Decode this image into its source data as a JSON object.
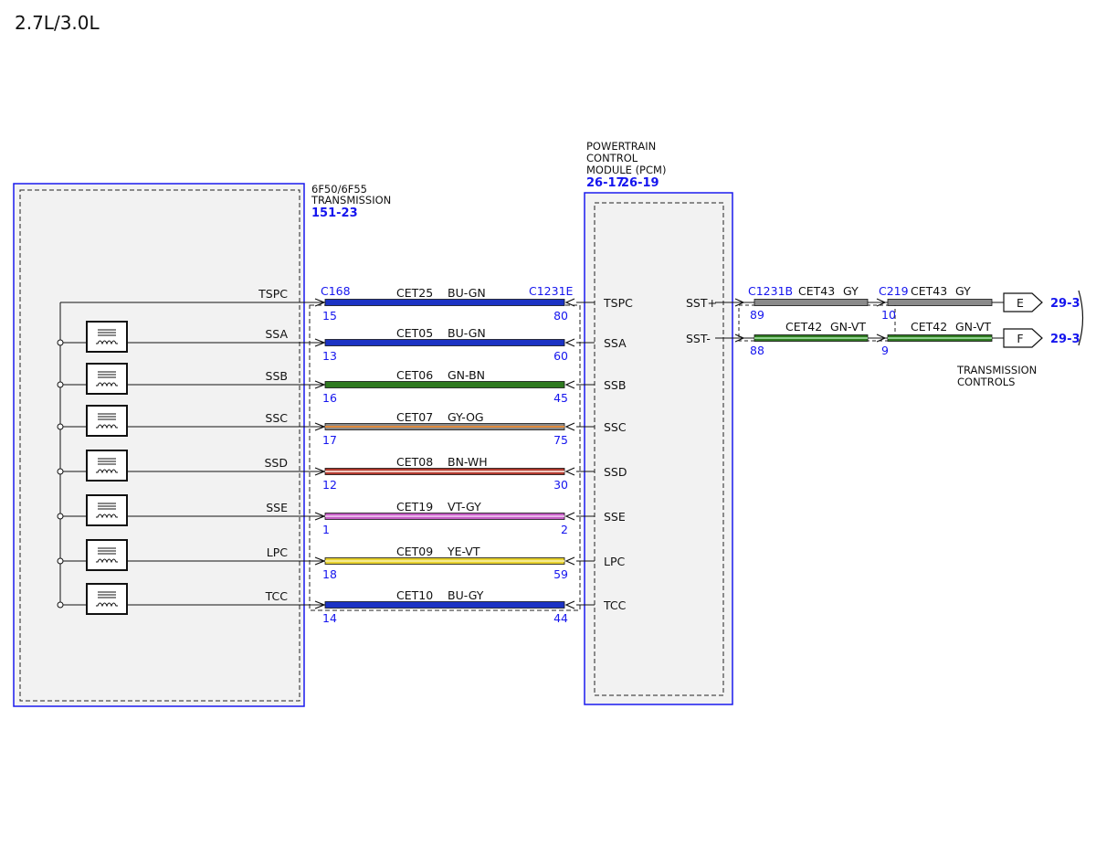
{
  "title": "2.7L/3.0L",
  "transmission": {
    "name_lines": [
      "6F50/6F55",
      "TRANSMISSION"
    ],
    "ref": "151-23",
    "connector": "C168"
  },
  "pcm": {
    "name_lines": [
      "POWERTRAIN",
      "CONTROL",
      "MODULE (PCM)"
    ],
    "refs": [
      "26-17",
      "26-19"
    ],
    "connector": "C1231E"
  },
  "solenoid_circuits": [
    {
      "signal": "TSPC",
      "circuit": "CET25",
      "color_code": "BU-GN",
      "trans_pin": "15",
      "pcm_pin": "80",
      "wire_colors": [
        "#1c33c4",
        "#1c33c4"
      ],
      "has_solenoid": false
    },
    {
      "signal": "SSA",
      "circuit": "CET05",
      "color_code": "BU-GN",
      "trans_pin": "13",
      "pcm_pin": "60",
      "wire_colors": [
        "#1c33c4",
        "#1c33c4"
      ],
      "has_solenoid": true
    },
    {
      "signal": "SSB",
      "circuit": "CET06",
      "color_code": "GN-BN",
      "trans_pin": "16",
      "pcm_pin": "45",
      "wire_colors": [
        "#2f7a20",
        "#2f7a20"
      ],
      "has_solenoid": true
    },
    {
      "signal": "SSC",
      "circuit": "CET07",
      "color_code": "GY-OG",
      "trans_pin": "17",
      "pcm_pin": "75",
      "wire_colors": [
        "#8a8a8a",
        "#e08a3c"
      ],
      "has_solenoid": true
    },
    {
      "signal": "SSD",
      "circuit": "CET08",
      "color_code": "BN-WH",
      "trans_pin": "12",
      "pcm_pin": "30",
      "wire_colors": [
        "#b23b30",
        "#f0c8c0"
      ],
      "has_solenoid": true
    },
    {
      "signal": "SSE",
      "circuit": "CET19",
      "color_code": "VT-GY",
      "trans_pin": "1",
      "pcm_pin": "2",
      "wire_colors": [
        "#c75fc7",
        "#e8b6e8"
      ],
      "has_solenoid": true
    },
    {
      "signal": "LPC",
      "circuit": "CET09",
      "color_code": "YE-VT",
      "trans_pin": "18",
      "pcm_pin": "59",
      "wire_colors": [
        "#e8d230",
        "#f5ea90"
      ],
      "has_solenoid": true
    },
    {
      "signal": "TCC",
      "circuit": "CET10",
      "color_code": "BU-GY",
      "trans_pin": "14",
      "pcm_pin": "44",
      "wire_colors": [
        "#1c33c4",
        "#1c33c4"
      ],
      "has_solenoid": true
    }
  ],
  "sensor_circuits": [
    {
      "signal": "SST+",
      "pcm_connector": "C1231B",
      "pcm_pin": "89",
      "circuit1": "CET43",
      "color1": "GY",
      "inline_connector": "C219",
      "inline_pin": "10",
      "circuit2": "CET43",
      "color2": "GY",
      "tag": "E",
      "ref": "29-3",
      "wire_colors": [
        "#8a8a8a",
        "#8a8a8a"
      ]
    },
    {
      "signal": "SST-",
      "pcm_connector": "",
      "pcm_pin": "88",
      "circuit1": "CET42",
      "color1": "GN-VT",
      "inline_connector": "",
      "inline_pin": "9",
      "circuit2": "CET42",
      "color2": "GN-VT",
      "tag": "F",
      "ref": "29-3",
      "wire_colors": [
        "#2f7a20",
        "#8fd08f"
      ]
    }
  ],
  "destination_note": [
    "TRANSMISSION",
    "CONTROLS"
  ],
  "colors": {
    "connector_blue": "#1515ee",
    "box_fill": "#f2f2f2"
  }
}
